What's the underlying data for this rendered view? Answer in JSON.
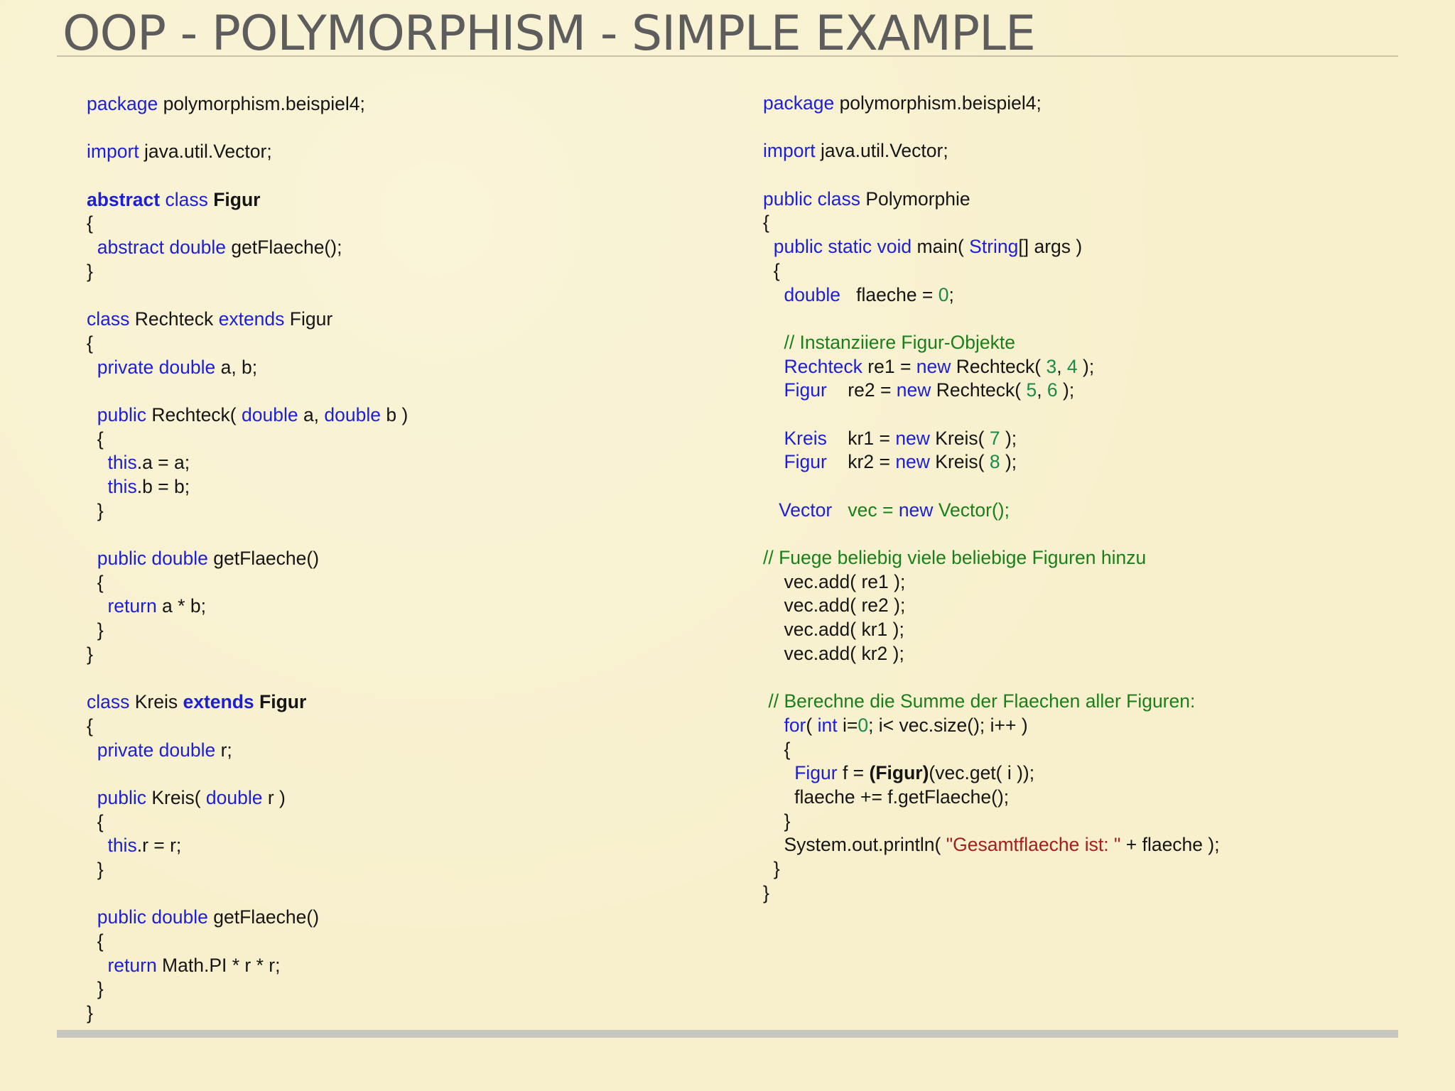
{
  "slide": {
    "title": "OOP - POLYMORPHISM - SIMPLE EXAMPLE"
  },
  "colors": {
    "background": "#f8f0cc",
    "title": "#5d5d5d",
    "keyword": "#1c1fd6",
    "comment": "#1a7f1a",
    "number": "#1a8a4a",
    "string": "#a2201c",
    "text": "#151515"
  },
  "left_code": [
    [
      {
        "t": "package",
        "c": "kw"
      },
      {
        "t": " polymorphism.beispiel4;"
      }
    ],
    [],
    [
      {
        "t": "import",
        "c": "kw"
      },
      {
        "t": " java.util.Vector;"
      }
    ],
    [],
    [
      {
        "t": "abstract",
        "c": "kw b"
      },
      {
        "t": " "
      },
      {
        "t": "class",
        "c": "kw"
      },
      {
        "t": " "
      },
      {
        "t": "Figur",
        "c": "b"
      }
    ],
    [
      {
        "t": "{"
      }
    ],
    [
      {
        "t": "  "
      },
      {
        "t": "abstract double",
        "c": "kw"
      },
      {
        "t": " getFlaeche();"
      }
    ],
    [
      {
        "t": "}"
      }
    ],
    [],
    [
      {
        "t": "class",
        "c": "kw"
      },
      {
        "t": " Rechteck "
      },
      {
        "t": "extends",
        "c": "kw"
      },
      {
        "t": " Figur"
      }
    ],
    [
      {
        "t": "{"
      }
    ],
    [
      {
        "t": "  "
      },
      {
        "t": "private double",
        "c": "kw"
      },
      {
        "t": " a, b;"
      }
    ],
    [],
    [
      {
        "t": "  "
      },
      {
        "t": "public",
        "c": "kw"
      },
      {
        "t": " Rechteck( "
      },
      {
        "t": "double",
        "c": "kw"
      },
      {
        "t": " a, "
      },
      {
        "t": "double",
        "c": "kw"
      },
      {
        "t": " b )"
      }
    ],
    [
      {
        "t": "  {"
      }
    ],
    [
      {
        "t": "    "
      },
      {
        "t": "this",
        "c": "kw"
      },
      {
        "t": ".a = a;"
      }
    ],
    [
      {
        "t": "    "
      },
      {
        "t": "this",
        "c": "kw"
      },
      {
        "t": ".b = b;"
      }
    ],
    [
      {
        "t": "  }"
      }
    ],
    [],
    [
      {
        "t": "  "
      },
      {
        "t": "public double",
        "c": "kw"
      },
      {
        "t": " getFlaeche()"
      }
    ],
    [
      {
        "t": "  {"
      }
    ],
    [
      {
        "t": "    "
      },
      {
        "t": "return",
        "c": "kw"
      },
      {
        "t": " a * b;"
      }
    ],
    [
      {
        "t": "  }"
      }
    ],
    [
      {
        "t": "}"
      }
    ],
    [],
    [
      {
        "t": "class",
        "c": "kw"
      },
      {
        "t": " Kreis "
      },
      {
        "t": "extends",
        "c": "kw b"
      },
      {
        "t": " "
      },
      {
        "t": "Figur",
        "c": "b"
      }
    ],
    [
      {
        "t": "{"
      }
    ],
    [
      {
        "t": "  "
      },
      {
        "t": "private double",
        "c": "kw"
      },
      {
        "t": " r;"
      }
    ],
    [],
    [
      {
        "t": "  "
      },
      {
        "t": "public",
        "c": "kw"
      },
      {
        "t": " Kreis( "
      },
      {
        "t": "double",
        "c": "kw"
      },
      {
        "t": " r )"
      }
    ],
    [
      {
        "t": "  {"
      }
    ],
    [
      {
        "t": "    "
      },
      {
        "t": "this",
        "c": "kw"
      },
      {
        "t": ".r = r;"
      }
    ],
    [
      {
        "t": "  }"
      }
    ],
    [],
    [
      {
        "t": "  "
      },
      {
        "t": "public double",
        "c": "kw"
      },
      {
        "t": " getFlaeche()"
      }
    ],
    [
      {
        "t": "  {"
      }
    ],
    [
      {
        "t": "    "
      },
      {
        "t": "return",
        "c": "kw"
      },
      {
        "t": " Math.PI * r * r;"
      }
    ],
    [
      {
        "t": "  }"
      }
    ],
    [
      {
        "t": "}"
      }
    ]
  ],
  "right_code": [
    [
      {
        "t": "package",
        "c": "kw"
      },
      {
        "t": " polymorphism.beispiel4;"
      }
    ],
    [],
    [
      {
        "t": "import",
        "c": "kw"
      },
      {
        "t": " java.util.Vector;"
      }
    ],
    [],
    [
      {
        "t": "public class",
        "c": "kw"
      },
      {
        "t": " Polymorphie"
      }
    ],
    [
      {
        "t": "{"
      }
    ],
    [
      {
        "t": "  "
      },
      {
        "t": "public static void",
        "c": "kw"
      },
      {
        "t": " main( "
      },
      {
        "t": "String",
        "c": "kw"
      },
      {
        "t": "[] args )"
      }
    ],
    [
      {
        "t": "  {"
      }
    ],
    [
      {
        "t": "    "
      },
      {
        "t": "double",
        "c": "kw"
      },
      {
        "t": "   flaeche = "
      },
      {
        "t": "0",
        "c": "num"
      },
      {
        "t": ";"
      }
    ],
    [],
    [
      {
        "t": "    "
      },
      {
        "t": "// Instanziiere Figur-Objekte",
        "c": "cm"
      }
    ],
    [
      {
        "t": "    "
      },
      {
        "t": "Rechteck",
        "c": "kw"
      },
      {
        "t": " re1 = "
      },
      {
        "t": "new",
        "c": "kw"
      },
      {
        "t": " Rechteck( "
      },
      {
        "t": "3",
        "c": "num"
      },
      {
        "t": ", "
      },
      {
        "t": "4",
        "c": "num"
      },
      {
        "t": " );"
      }
    ],
    [
      {
        "t": "    "
      },
      {
        "t": "Figur",
        "c": "kw"
      },
      {
        "t": "    re2 = "
      },
      {
        "t": "new",
        "c": "kw"
      },
      {
        "t": " Rechteck( "
      },
      {
        "t": "5",
        "c": "num"
      },
      {
        "t": ", "
      },
      {
        "t": "6",
        "c": "num"
      },
      {
        "t": " );"
      }
    ],
    [],
    [
      {
        "t": "    "
      },
      {
        "t": "Kreis",
        "c": "kw"
      },
      {
        "t": "    kr1 = "
      },
      {
        "t": "new",
        "c": "kw"
      },
      {
        "t": " Kreis( "
      },
      {
        "t": "7",
        "c": "num"
      },
      {
        "t": " );"
      }
    ],
    [
      {
        "t": "    "
      },
      {
        "t": "Figur",
        "c": "kw"
      },
      {
        "t": "    kr2 = "
      },
      {
        "t": "new",
        "c": "kw"
      },
      {
        "t": " Kreis( "
      },
      {
        "t": "8",
        "c": "num"
      },
      {
        "t": " );"
      }
    ],
    [],
    [
      {
        "t": "   "
      },
      {
        "t": "Vector",
        "c": "kw"
      },
      {
        "t": "   "
      },
      {
        "t": "vec",
        "c": "cm"
      },
      {
        "t": " "
      },
      {
        "t": "=",
        "c": "cm"
      },
      {
        "t": " "
      },
      {
        "t": "new",
        "c": "kw"
      },
      {
        "t": " "
      },
      {
        "t": "Vector();",
        "c": "cm"
      }
    ],
    [],
    [
      {
        "t": "// Fuege beliebig viele beliebige Figuren hinzu",
        "c": "cm"
      }
    ],
    [
      {
        "t": "    vec.add( re1 );"
      }
    ],
    [
      {
        "t": "    vec.add( re2 );"
      }
    ],
    [
      {
        "t": "    vec.add( kr1 );"
      }
    ],
    [
      {
        "t": "    vec.add( kr2 );"
      }
    ],
    [],
    [
      {
        "t": " "
      },
      {
        "t": "// Berechne die Summe der Flaechen aller Figuren:",
        "c": "cm"
      }
    ],
    [
      {
        "t": "    "
      },
      {
        "t": "for",
        "c": "kw"
      },
      {
        "t": "( "
      },
      {
        "t": "int",
        "c": "kw"
      },
      {
        "t": " i="
      },
      {
        "t": "0",
        "c": "num"
      },
      {
        "t": "; i< vec.size(); i++ )"
      }
    ],
    [
      {
        "t": "    {"
      }
    ],
    [
      {
        "t": "      "
      },
      {
        "t": "Figur",
        "c": "kw"
      },
      {
        "t": " f = "
      },
      {
        "t": "(Figur)",
        "c": "b"
      },
      {
        "t": "(vec.get( i ));"
      }
    ],
    [
      {
        "t": "      flaeche += f.getFlaeche();"
      }
    ],
    [
      {
        "t": "    }"
      }
    ],
    [
      {
        "t": "    System.out.println( "
      },
      {
        "t": "\"Gesamtflaeche ist: \"",
        "c": "str"
      },
      {
        "t": " + flaeche );"
      }
    ],
    [
      {
        "t": "  }"
      }
    ],
    [
      {
        "t": "}"
      }
    ]
  ]
}
